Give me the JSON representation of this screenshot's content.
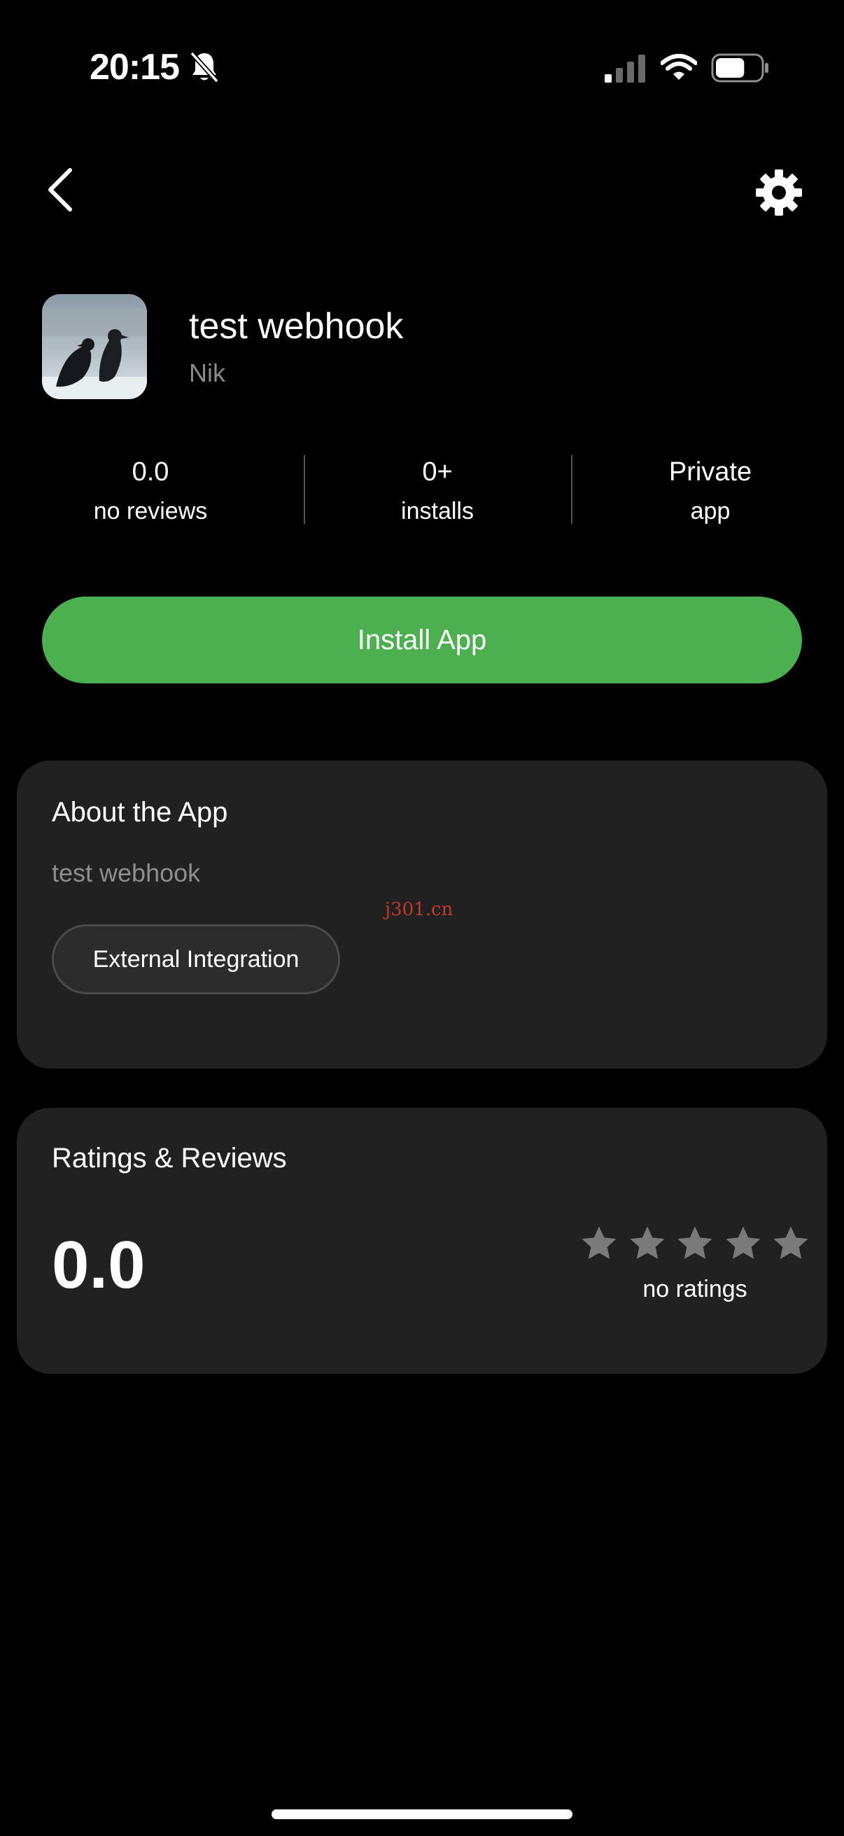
{
  "status_bar": {
    "time": "20:15",
    "battery_level": 0.65
  },
  "app": {
    "title": "test webhook",
    "author": "Nik"
  },
  "stats": [
    {
      "value": "0.0",
      "label": "no reviews"
    },
    {
      "value": "0+",
      "label": "installs"
    },
    {
      "value": "Private",
      "label": "app"
    }
  ],
  "install_button": {
    "label": "Install App",
    "color": "#4caf50"
  },
  "about": {
    "title": "About the App",
    "description": "test webhook",
    "tag": "External Integration",
    "watermark": "j301.cn"
  },
  "ratings": {
    "title": "Ratings & Reviews",
    "value": "0.0",
    "stars_filled": 0,
    "stars_total": 5,
    "caption": "no ratings"
  },
  "icons": {
    "back": "chevron-left-icon",
    "settings": "gear-icon",
    "bell": "bell-slash-icon",
    "signal": "cellular-signal-icon",
    "wifi": "wifi-icon",
    "battery": "battery-icon",
    "star": "star-icon"
  }
}
